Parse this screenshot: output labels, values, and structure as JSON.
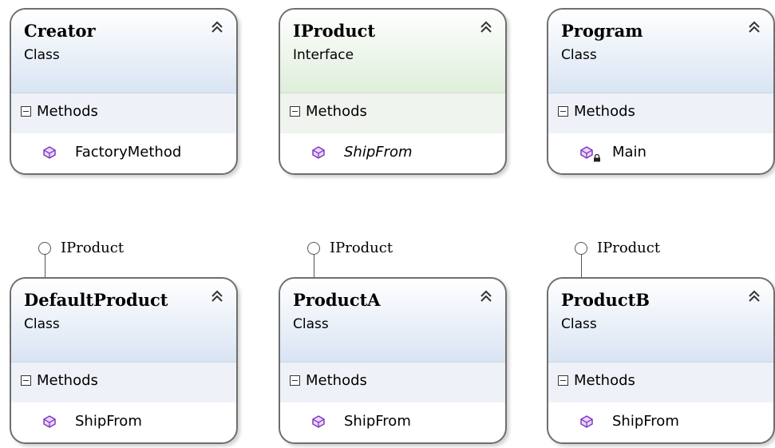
{
  "boxes": [
    {
      "name": "Creator",
      "kind": "Class",
      "section": "Methods",
      "member": "FactoryMethod",
      "member_style": "normal",
      "member_access": "public"
    },
    {
      "name": "IProduct",
      "kind": "Interface",
      "section": "Methods",
      "member": "ShipFrom",
      "member_style": "italic",
      "member_access": "public"
    },
    {
      "name": "Program",
      "kind": "Class",
      "section": "Methods",
      "member": "Main",
      "member_style": "normal",
      "member_access": "private"
    },
    {
      "name": "DefaultProduct",
      "kind": "Class",
      "section": "Methods",
      "member": "ShipFrom",
      "member_style": "normal",
      "member_access": "public",
      "implements": "IProduct"
    },
    {
      "name": "ProductA",
      "kind": "Class",
      "section": "Methods",
      "member": "ShipFrom",
      "member_style": "normal",
      "member_access": "public",
      "implements": "IProduct"
    },
    {
      "name": "ProductB",
      "kind": "Class",
      "section": "Methods",
      "member": "ShipFrom",
      "member_style": "normal",
      "member_access": "public",
      "implements": "IProduct"
    }
  ],
  "colors": {
    "class_header": "#d9e4f3",
    "interface_header": "#dfeedb",
    "border": "#6e6e6e",
    "method_icon": "#8a2be2"
  },
  "icons": {
    "collapse": "double-chevron-up-icon",
    "section_toggle": "minus-box-icon",
    "method": "method-cube-icon",
    "private": "lock-icon",
    "interface_lollipop": "lollipop-icon"
  }
}
